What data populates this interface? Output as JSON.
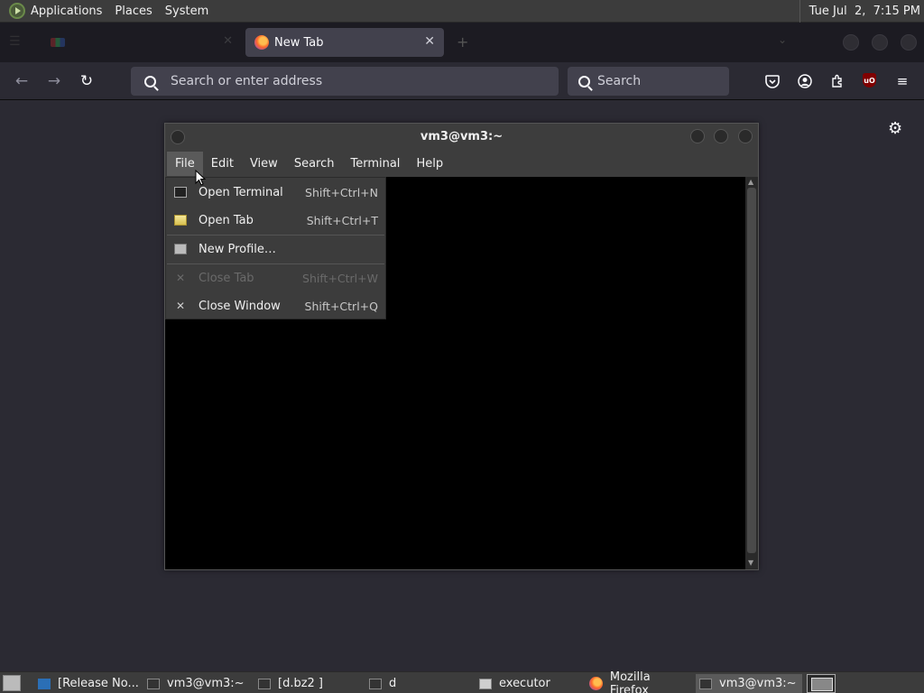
{
  "top_panel": {
    "menus": [
      "Applications",
      "Places",
      "System"
    ],
    "clock": "Tue Jul  2,  7:15 PM"
  },
  "browser": {
    "tabs": [
      {
        "label": "",
        "active": false
      },
      {
        "label": "New Tab",
        "active": true
      }
    ],
    "url_placeholder": "Search or enter address",
    "search_placeholder": "Search",
    "ublock_label": "uO"
  },
  "terminal": {
    "title": "vm3@vm3:~",
    "menus": [
      "File",
      "Edit",
      "View",
      "Search",
      "Terminal",
      "Help"
    ],
    "active_menu": "File"
  },
  "file_menu": {
    "items": [
      {
        "label": "Open Terminal",
        "shortcut": "Shift+Ctrl+N",
        "icon": "terminal-icon",
        "disabled": false
      },
      {
        "label": "Open Tab",
        "shortcut": "Shift+Ctrl+T",
        "icon": "tab-icon",
        "disabled": false
      },
      {
        "label": "New Profile…",
        "shortcut": "",
        "icon": "profile-icon",
        "disabled": false
      },
      {
        "label": "Close Tab",
        "shortcut": "Shift+Ctrl+W",
        "icon": "close-icon",
        "disabled": true
      },
      {
        "label": "Close Window",
        "shortcut": "Shift+Ctrl+Q",
        "icon": "close-icon",
        "disabled": false
      }
    ]
  },
  "taskbar": {
    "items": [
      {
        "label": "[Release No...",
        "icon": "vscode-icon"
      },
      {
        "label": "vm3@vm3:~",
        "icon": "terminal-icon"
      },
      {
        "label": "[d.bz2 ]",
        "icon": "archive-icon"
      },
      {
        "label": "d",
        "icon": "archive-icon"
      },
      {
        "label": "executor",
        "icon": "folder-icon"
      },
      {
        "label": "Mozilla Firefox",
        "icon": "firefox-icon"
      },
      {
        "label": "vm3@vm3:~",
        "icon": "terminal-icon",
        "active": true
      }
    ]
  }
}
